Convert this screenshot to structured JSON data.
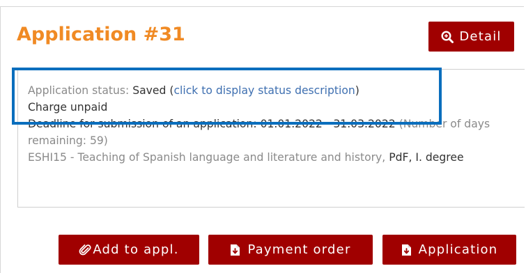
{
  "application": {
    "title": "Application #31",
    "detail_button_label": "Detail"
  },
  "status": {
    "prefix": "Application status: ",
    "value": "Saved",
    "open_paren": " (",
    "description_link": "click to display status description",
    "close_paren": ")",
    "charge": "Charge unpaid"
  },
  "deadline": {
    "label": "Deadline for submission of an application: ",
    "range": "01.01.2022 - 31.03.2022",
    "remaining": " (Number of days remaining: 59)"
  },
  "program": {
    "name": "ESHI15 - Teaching of Spanish language and literature and history",
    "sep": ", ",
    "level": "PdF, I. degree"
  },
  "actions": {
    "add_label": "Add to appl.",
    "payment_label": "Payment order",
    "application_label": "Application"
  },
  "colors": {
    "title": "#f08a24",
    "button": "#a00000",
    "link": "#3e6fb0",
    "highlight": "#0a6ebd"
  }
}
